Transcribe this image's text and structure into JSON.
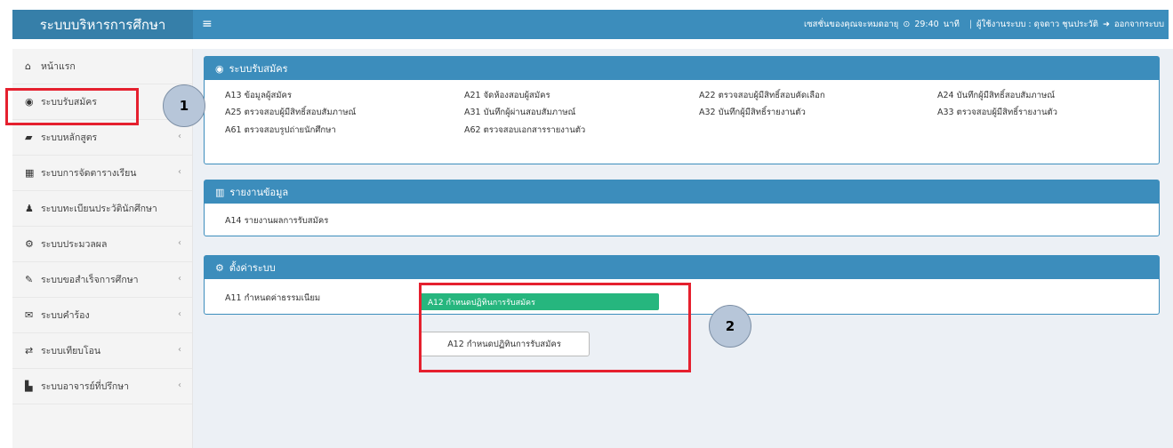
{
  "brand": {
    "title": "ระบบบริหารการศึกษา"
  },
  "navbar": {
    "hamburger": "≡",
    "session": "เซสชั่นของคุณจะหมดอายุ",
    "timer": "29:40",
    "timer_unit": "นาที",
    "separator": "|",
    "user": "ผู้ใช้งานระบบ : ดุจดาว ชุนประวัติ",
    "logout": "ออกจากระบบ"
  },
  "sidebar": {
    "items": [
      {
        "label": "หน้าแรก",
        "icon": "home-icon",
        "glyph": "⌂",
        "chevron": ""
      },
      {
        "label": "ระบบรับสมัคร",
        "icon": "user-circle-icon",
        "glyph": "◉",
        "chevron": ""
      },
      {
        "label": "ระบบหลักสูตร",
        "icon": "book-icon",
        "glyph": "▰",
        "chevron": "‹"
      },
      {
        "label": "ระบบการจัดตารางเรียน",
        "icon": "table-icon",
        "glyph": "▦",
        "chevron": "‹"
      },
      {
        "label": "ระบบทะเบียนประวัตินักศึกษา",
        "icon": "user-icon",
        "glyph": "♟",
        "chevron": ""
      },
      {
        "label": "ระบบประมวลผล",
        "icon": "cogs-icon",
        "glyph": "⚙",
        "chevron": "‹"
      },
      {
        "label": "ระบบขอสำเร็จการศึกษา",
        "icon": "wrench-icon",
        "glyph": "✎",
        "chevron": "‹"
      },
      {
        "label": "ระบบคำร้อง",
        "icon": "envelope-icon",
        "glyph": "✉",
        "chevron": "‹"
      },
      {
        "label": "ระบบเทียบโอน",
        "icon": "exchange-icon",
        "glyph": "⇄",
        "chevron": "‹"
      },
      {
        "label": "ระบบอาจารย์ที่ปรึกษา",
        "icon": "building-icon",
        "glyph": "▙",
        "chevron": "‹"
      }
    ]
  },
  "panels": {
    "admission": {
      "title": "ระบบรับสมัคร",
      "icon": "user-circle-icon",
      "links": [
        "A13 ข้อมูลผู้สมัคร",
        "A21 จัดห้องสอบผู้สมัคร",
        "A22 ตรวจสอบผู้มีสิทธิ์สอบคัดเลือก",
        "A24 บันทึกผู้มีสิทธิ์สอบสัมภาษณ์",
        "A25 ตรวจสอบผู้มีสิทธิ์สอบสัมภาษณ์",
        "A31 บันทึกผู้ผ่านสอบสัมภาษณ์",
        "A32 บันทึกผู้มีสิทธิ์รายงานตัว",
        "A33 ตรวจสอบผู้มีสิทธิ์รายงานตัว",
        "A61 ตรวจสอบรูปถ่ายนักศึกษา",
        "A62 ตรวจสอบเอกสารรายงานตัว"
      ]
    },
    "report": {
      "title": "รายงานข้อมูล",
      "icon": "bar-chart-icon",
      "links": [
        "A14 รายงานผลการรับสมัคร"
      ]
    },
    "settings": {
      "title": "ตั้งค่าระบบ",
      "icon": "cogs-icon",
      "links": [
        "A11 กำหนดค่าธรรมเนียม"
      ]
    }
  },
  "highlight_button": "A12 กำหนดปฏิทินการรับสมัคร",
  "plain_button": "A12 กำหนดปฏิทินการรับสมัคร",
  "markers": {
    "first": "1",
    "second": "2"
  },
  "colors": {
    "primary": "#3c8dbc",
    "brand": "#367fa9",
    "success": "#26b67e",
    "annotation": "#e5202e"
  }
}
